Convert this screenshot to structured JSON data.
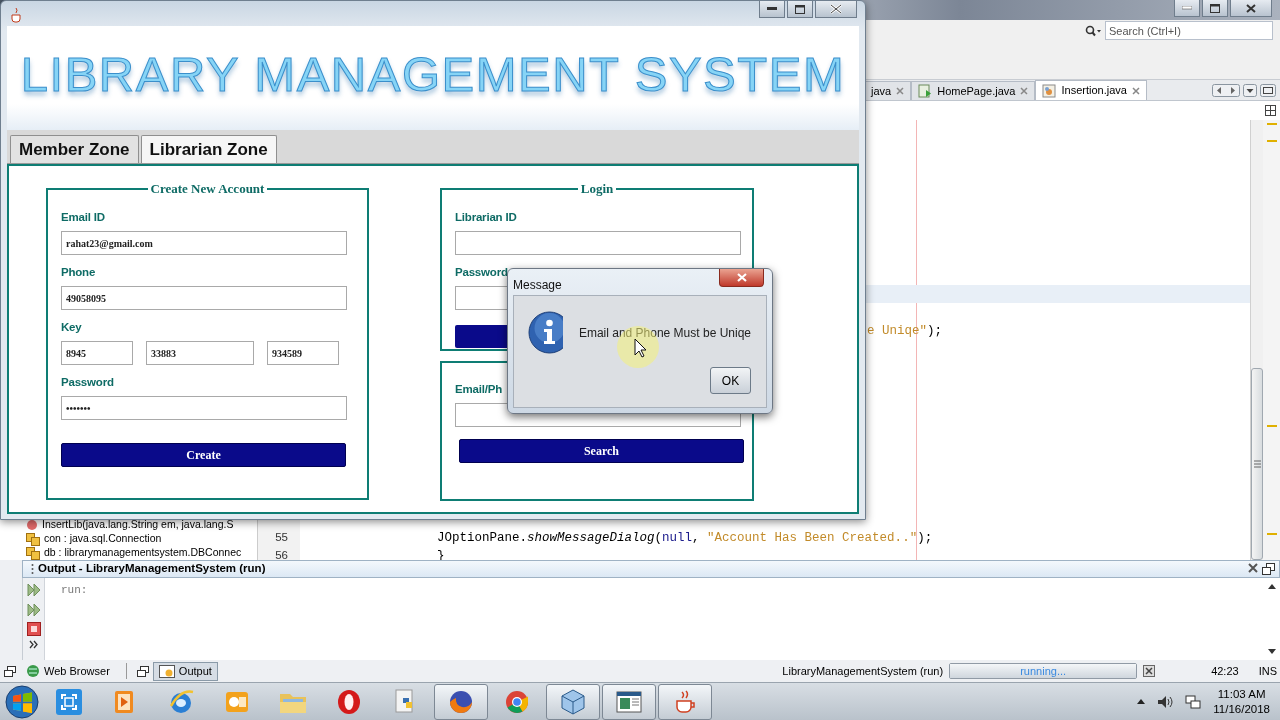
{
  "ide": {
    "search": {
      "placeholder": "Search (Ctrl+I)"
    },
    "editor_tabs": [
      {
        "label": "java",
        "selected": false
      },
      {
        "label": "HomePage.java",
        "selected": false
      },
      {
        "label": "Insertion.java",
        "selected": true
      }
    ],
    "navigator_items": [
      {
        "kind": "method",
        "label": "InsertLib(java.lang.String em, java.lang.S"
      },
      {
        "kind": "field",
        "label": "con : java.sql.Connection"
      },
      {
        "kind": "field",
        "label": "db : librarymanagementsystem.DBConnec"
      }
    ],
    "code_lines": [
      {
        "tokens": [
          {
            "kind": "string",
            "text": "e Uniqe\""
          },
          {
            "kind": "plain",
            "text": ");"
          }
        ]
      },
      {
        "number": "55",
        "tokens": [
          {
            "kind": "plain",
            "text": "JOptionPane."
          },
          {
            "kind": "method",
            "text": "showMessageDialog"
          },
          {
            "kind": "plain",
            "text": "("
          },
          {
            "kind": "keyword",
            "text": "null"
          },
          {
            "kind": "plain",
            "text": ", "
          },
          {
            "kind": "string",
            "text": "\"Account Has Been Created..\""
          },
          {
            "kind": "plain",
            "text": ");"
          }
        ]
      },
      {
        "number": "56",
        "tokens": [
          {
            "kind": "plain",
            "text": "}"
          }
        ]
      }
    ],
    "output": {
      "title": "Output - LibraryManagementSystem (run)",
      "lines": [
        "run:"
      ]
    },
    "bottom_tabs": [
      {
        "label": "Web Browser",
        "selected": false,
        "kind": "globe"
      },
      {
        "label": "Output",
        "selected": true,
        "kind": "output"
      }
    ],
    "status_bar": {
      "task": "LibraryManagementSystem (run)",
      "progress": {
        "label": "running...",
        "level": 1
      },
      "position": "42:23",
      "mode": "INS"
    }
  },
  "app": {
    "banner": "LIBRARY MANAGEMENT SYSTEM",
    "tabs": [
      {
        "label": "Member Zone",
        "selected": false
      },
      {
        "label": "Librarian Zone",
        "selected": true
      }
    ],
    "create_account": {
      "title": "Create New Account",
      "email": {
        "label": "Email ID",
        "value": "rahat23@gmail.com"
      },
      "phone": {
        "label": "Phone",
        "value": "49058095"
      },
      "key": {
        "label": "Key",
        "values": [
          "8945",
          "33883",
          "934589"
        ]
      },
      "password": {
        "label": "Password",
        "value": "•••••••"
      },
      "button": "Create"
    },
    "login": {
      "title": "Login",
      "id_label": "Librarian ID",
      "password_label": "Password"
    },
    "search": {
      "label": "Email/Ph",
      "button": "Search"
    }
  },
  "dialog": {
    "title": "Message",
    "message": "Email and Phone Must be Uniqe",
    "button": "OK"
  },
  "taskbar": {
    "apps": [
      {
        "kind": "capture",
        "running": false
      },
      {
        "kind": "media",
        "running": false
      },
      {
        "kind": "ie",
        "running": false
      },
      {
        "kind": "mail",
        "running": false
      },
      {
        "kind": "folder",
        "running": false
      },
      {
        "kind": "ring",
        "running": false
      },
      {
        "kind": "python",
        "running": false
      },
      {
        "kind": "firefox",
        "running": true
      },
      {
        "kind": "chrome",
        "running": false
      },
      {
        "kind": "cube",
        "running": true
      },
      {
        "kind": "window",
        "running": true
      },
      {
        "kind": "cup",
        "running": true
      }
    ],
    "time": "11:03 AM",
    "date": "11/16/2018"
  }
}
